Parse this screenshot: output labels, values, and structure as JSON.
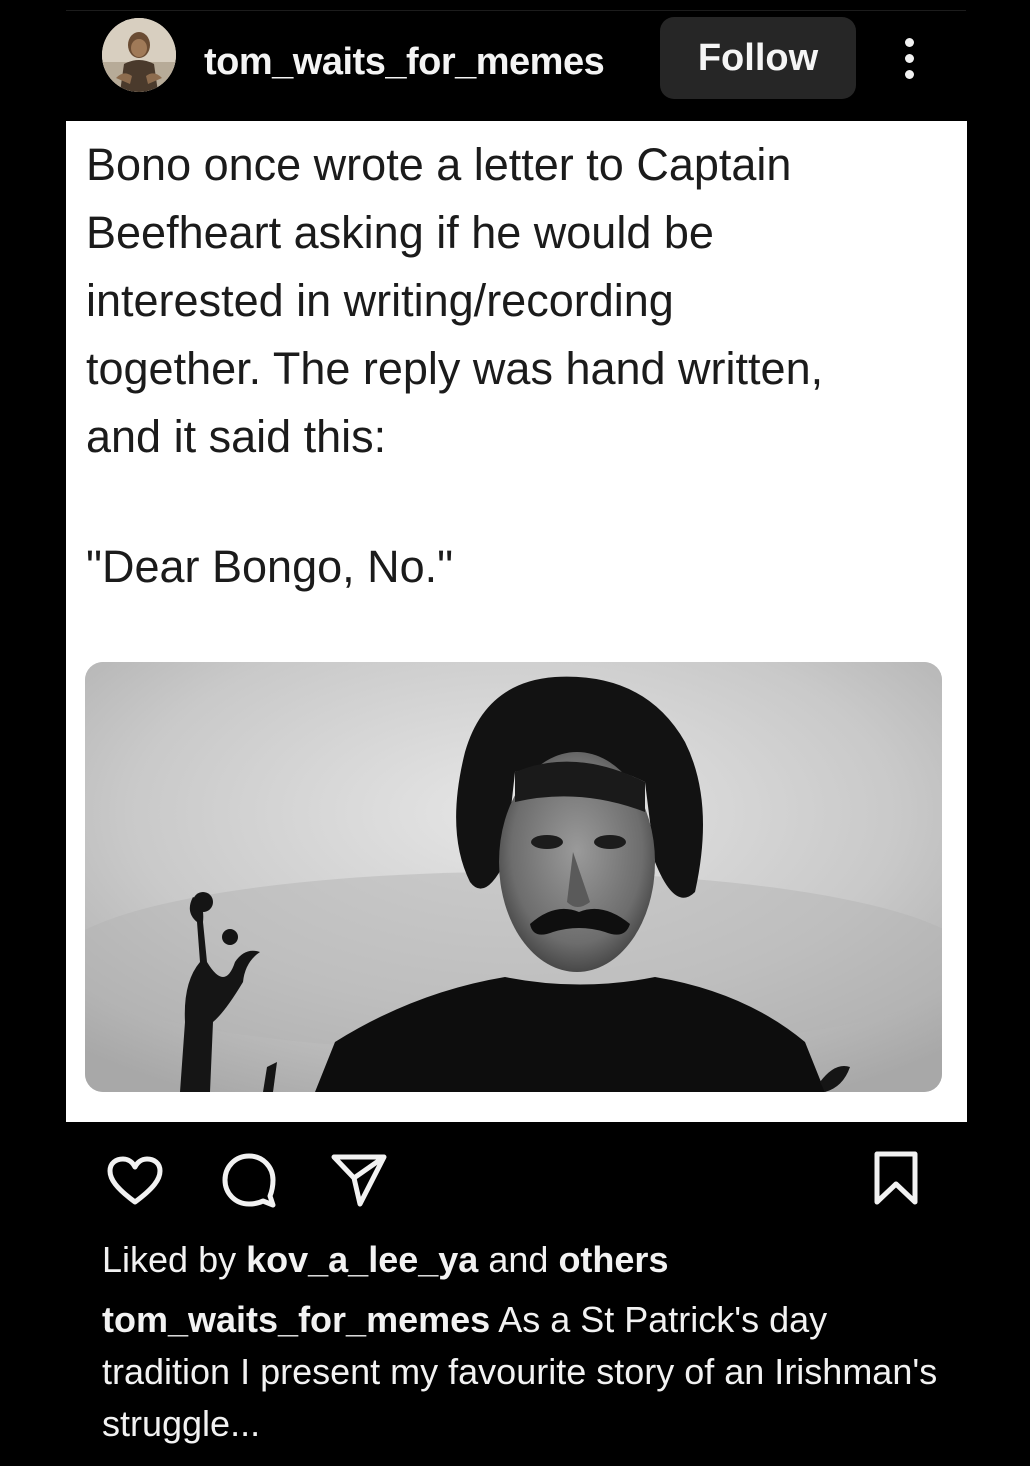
{
  "header": {
    "username": "tom_waits_for_memes",
    "follow_label": "Follow",
    "avatar_icon": "profile-avatar",
    "more_icon": "more-vertical-icon"
  },
  "post": {
    "text_lines": [
      "Bono once wrote a letter to Captain",
      "Beefheart asking if he would be",
      "interested in writing/recording",
      "together. The reply was hand written,",
      "and it said this:"
    ],
    "quote": "\"Dear Bongo, No.\"",
    "photo": "black-and-white portrait photo"
  },
  "actions": {
    "icons": [
      "heart-icon",
      "comment-icon",
      "share-icon",
      "bookmark-icon"
    ]
  },
  "likes": {
    "prefix": "Liked by",
    "user": "kov_a_lee_ya",
    "middle": "and",
    "suffix": "others"
  },
  "caption": {
    "username": "tom_waits_for_memes",
    "text": "As a St Patrick's day tradition I present my favourite story of an Irishman's struggle..."
  },
  "colors": {
    "background": "#000000",
    "card": "#ffffff",
    "button": "#262626",
    "text_light": "#f2f2f2",
    "text_dark": "#1b1b1b"
  }
}
